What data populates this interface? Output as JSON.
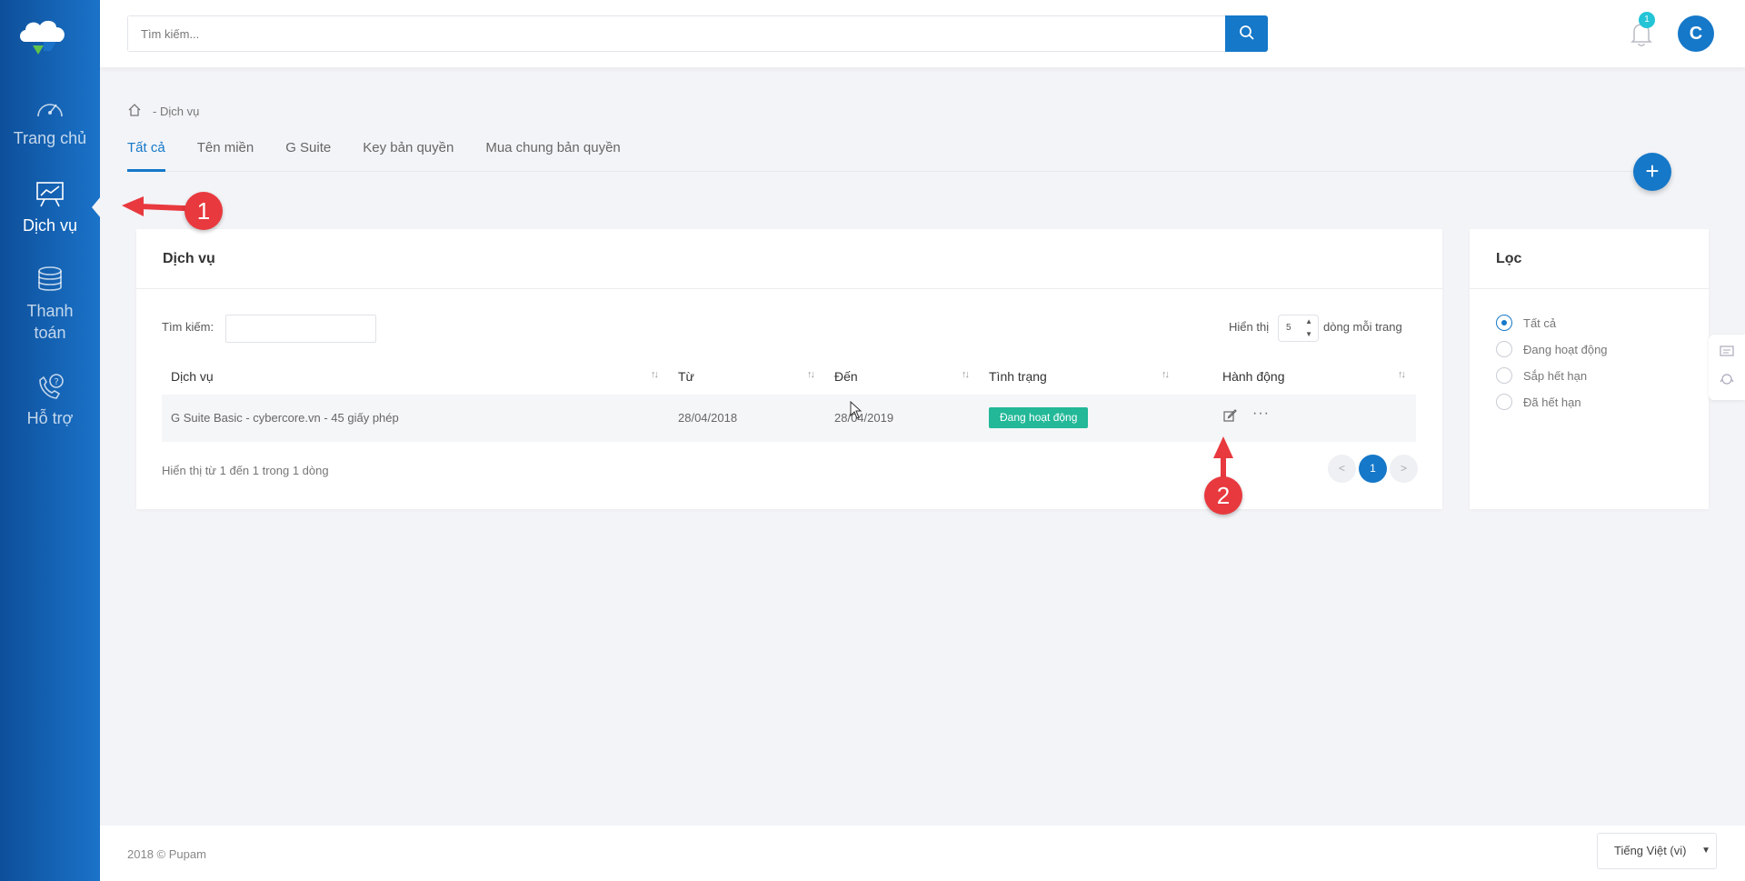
{
  "brand": {
    "accent": "#1578c9",
    "sidebar_dark": "#0d4f9a",
    "success": "#22b898",
    "annotation": "#e8393e"
  },
  "sidebar": {
    "items": [
      {
        "label": "Trang chủ",
        "icon": "dashboard-gauge-icon"
      },
      {
        "label": "Dịch vụ",
        "icon": "presentation-chart-icon"
      },
      {
        "label": "Thanh toán",
        "icon": "coins-stack-icon"
      },
      {
        "label": "Hỗ trợ",
        "icon": "phone-help-icon"
      }
    ],
    "active_index": 1
  },
  "header": {
    "search_placeholder": "Tìm kiếm...",
    "notification_count": "1",
    "avatar_letter": "C"
  },
  "breadcrumb": {
    "separator": "-",
    "current": "Dịch vụ"
  },
  "tabs": [
    "Tất cả",
    "Tên miền",
    "G Suite",
    "Key bản quyền",
    "Mua chung bản quyền"
  ],
  "fab_label": "+",
  "main": {
    "title": "Dịch vụ",
    "search_label": "Tìm kiếm:",
    "show_prefix": "Hiển thị",
    "show_value": "5",
    "show_suffix": "dòng mỗi trang",
    "columns": [
      "Dịch vụ",
      "Từ",
      "Đến",
      "Tình trạng",
      "Hành động"
    ],
    "rows": [
      {
        "service": "G Suite Basic - cybercore.vn - 45 giấy phép",
        "from": "28/04/2018",
        "to": "28/04/2019",
        "status": "Đang hoạt động"
      }
    ],
    "footer": "Hiển thị từ 1 đến 1 trong 1 dòng",
    "pagination": {
      "prev": "<",
      "current": "1",
      "next": ">"
    }
  },
  "filter": {
    "title": "Lọc",
    "options": [
      "Tất cả",
      "Đang hoạt động",
      "Sắp hết hạn",
      "Đã hết hạn"
    ],
    "selected_index": 0
  },
  "annotations": [
    "1",
    "2"
  ],
  "footer": {
    "copyright": "2018 © Pupam",
    "language": "Tiếng Việt (vi)"
  }
}
